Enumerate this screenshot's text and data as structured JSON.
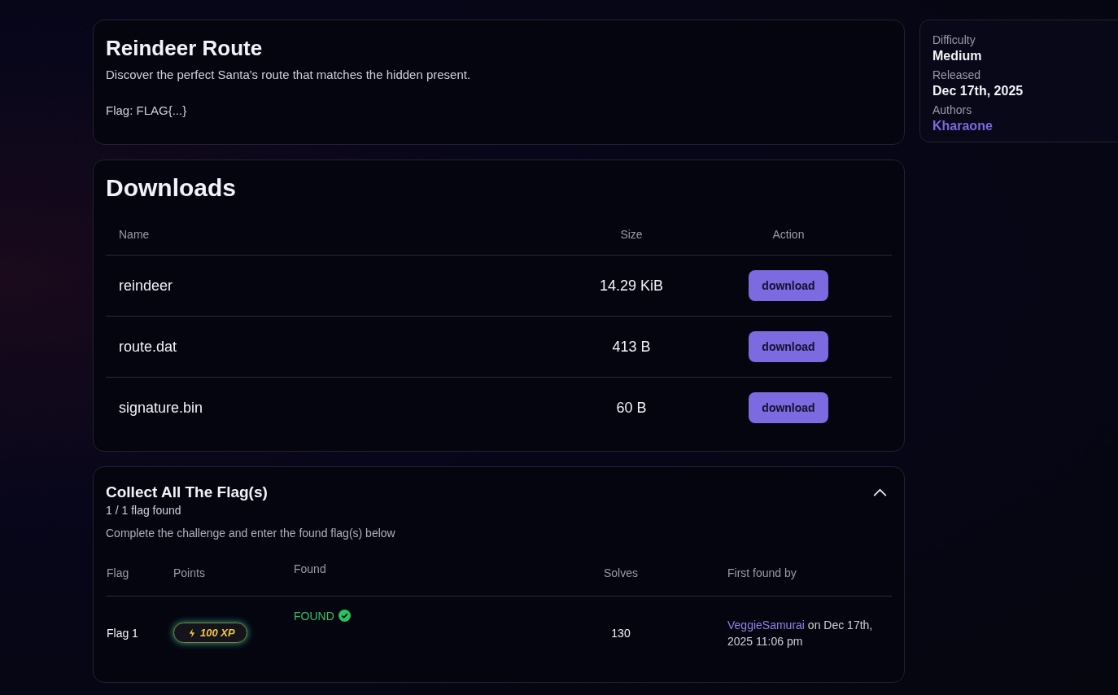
{
  "challenge": {
    "title": "Reindeer Route",
    "description": "Discover the perfect Santa's route that matches the hidden present.",
    "flag_format": "Flag: FLAG{...}"
  },
  "downloads": {
    "title": "Downloads",
    "columns": [
      "Name",
      "Size",
      "Action"
    ],
    "rows": [
      {
        "name": "reindeer",
        "size": "14.29 KiB",
        "action": "download"
      },
      {
        "name": "route.dat",
        "size": "413 B",
        "action": "download"
      },
      {
        "name": "signature.bin",
        "size": "60 B",
        "action": "download"
      }
    ]
  },
  "flags": {
    "title": "Collect All The Flag(s)",
    "progress": "1 / 1 flag found",
    "instructions": "Complete the challenge and enter the found flag(s) below",
    "expanded": true,
    "columns": [
      "Flag",
      "Points",
      "Found",
      "Solves",
      "First found by"
    ],
    "rows": [
      {
        "flag": "Flag 1",
        "points": "100 XP",
        "found": true,
        "found_label": "FOUND",
        "solves": "130",
        "first_found_user": "VeggieSamurai",
        "first_found_time": "on Dec 17th, 2025 11:06 pm"
      }
    ]
  },
  "details": [
    {
      "label": "Difficulty",
      "value": "Medium",
      "kind": "text"
    },
    {
      "label": "Released",
      "value": "Dec 17th, 2025",
      "kind": "text"
    },
    {
      "label": "Authors",
      "value": "Kharaone",
      "kind": "link"
    }
  ]
}
